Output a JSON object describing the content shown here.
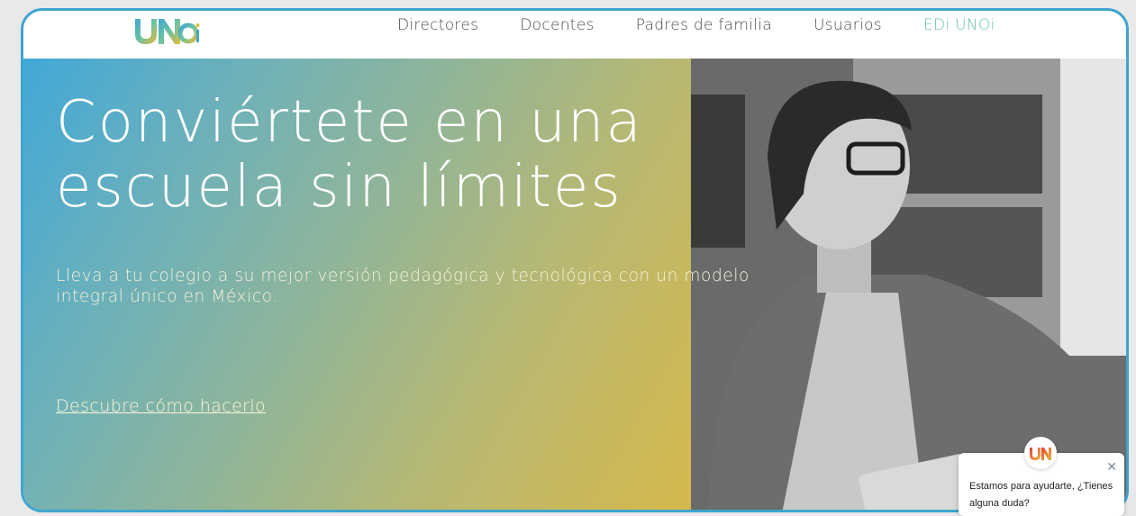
{
  "nav": {
    "items": [
      "Directores",
      "Docentes",
      "Padres de familia",
      "Usuarios",
      "EDi UNOi"
    ]
  },
  "hero": {
    "headline_line1": "Conviértete en una",
    "headline_line2": "escuela sin límites",
    "subtitle": "Lleva a tu colegio a su mejor versión pedagógica y tecnológica con un modelo integral único en México.",
    "cta": "Descubre cómo hacerlo"
  },
  "chat": {
    "message": "Estamos para ayudarte, ¿Tienes alguna duda?"
  },
  "colors": {
    "frame_border": "#3fa5cf",
    "nav_active": "#6bc6a2",
    "gradient_start": "#42a8d8",
    "gradient_end": "#d6b84a"
  },
  "icons": {
    "logo": "unoi-logo",
    "chat_avatar": "unoi-logo",
    "close": "close-icon"
  }
}
